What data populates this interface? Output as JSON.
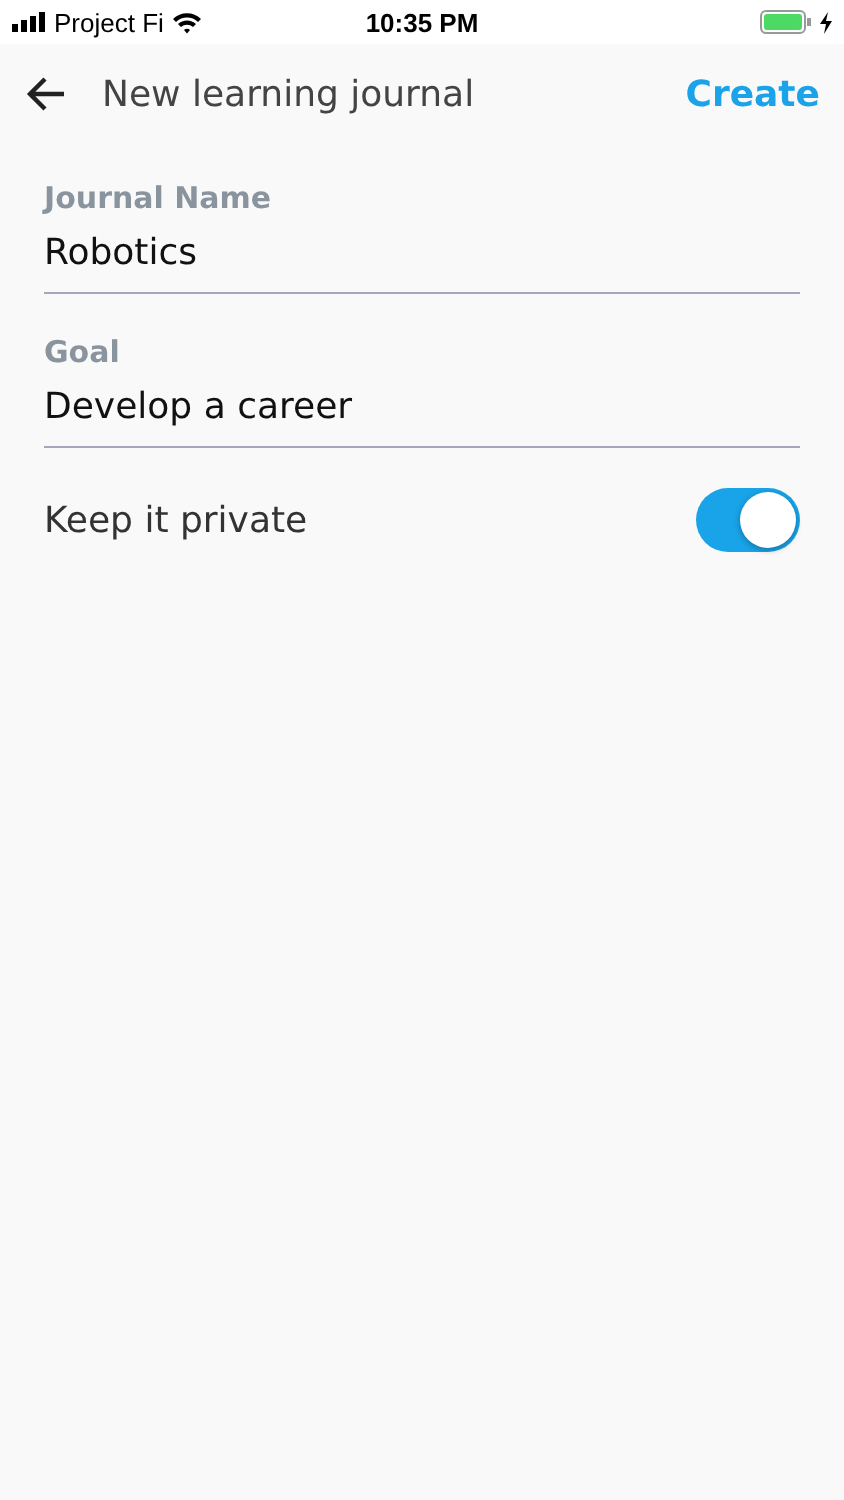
{
  "status_bar": {
    "carrier": "Project Fi",
    "time": "10:35 PM",
    "charging": true
  },
  "header": {
    "title": "New learning journal",
    "action": "Create"
  },
  "fields": [
    {
      "label": "Journal Name",
      "value": "Robotics"
    },
    {
      "label": "Goal",
      "value": "Develop a career"
    }
  ],
  "toggle": {
    "label": "Keep it private",
    "on": true
  }
}
